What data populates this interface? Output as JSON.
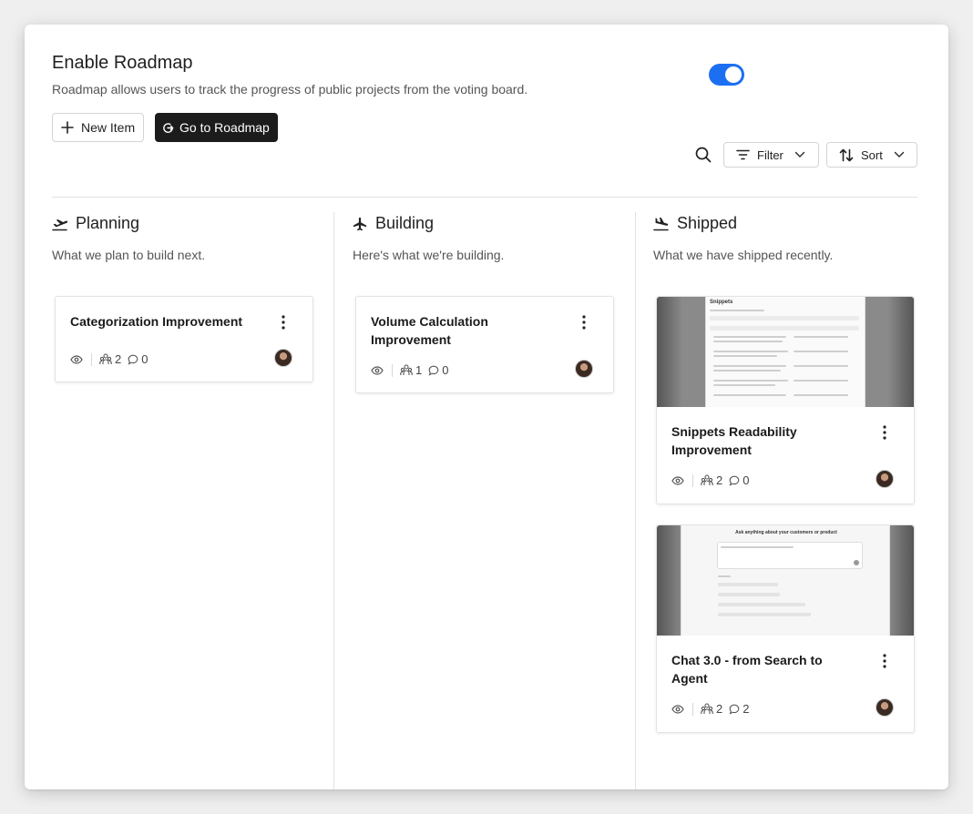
{
  "settings": {
    "title": "Enable Roadmap",
    "description": "Roadmap allows users to track the progress of public projects from the voting board.",
    "toggle_on": true,
    "accent_color": "#1d6ff2"
  },
  "toolbar": {
    "new_item_label": "New Item",
    "goto_label": "Go to Roadmap",
    "filter_label": "Filter",
    "sort_label": "Sort"
  },
  "columns": [
    {
      "title": "Planning",
      "icon": "airplane-takeoff-icon",
      "description": "What we plan to build next.",
      "cards": [
        {
          "title": "Categorization Improvement",
          "voters": "2",
          "comments": "0"
        }
      ]
    },
    {
      "title": "Building",
      "icon": "airplane-icon",
      "description": "Here's what we're building.",
      "cards": [
        {
          "title": "Volume Calculation Improvement",
          "voters": "1",
          "comments": "0"
        }
      ]
    },
    {
      "title": "Shipped",
      "icon": "airplane-landing-icon",
      "description": "What we have shipped recently.",
      "cards": [
        {
          "title": "Snippets Readability Improvement",
          "voters": "2",
          "comments": "0",
          "thumb_heading": "Snippets"
        },
        {
          "title": "Chat 3.0 - from Search to Agent",
          "voters": "2",
          "comments": "2",
          "thumb_heading": "Ask anything about your customers or product"
        }
      ]
    }
  ]
}
